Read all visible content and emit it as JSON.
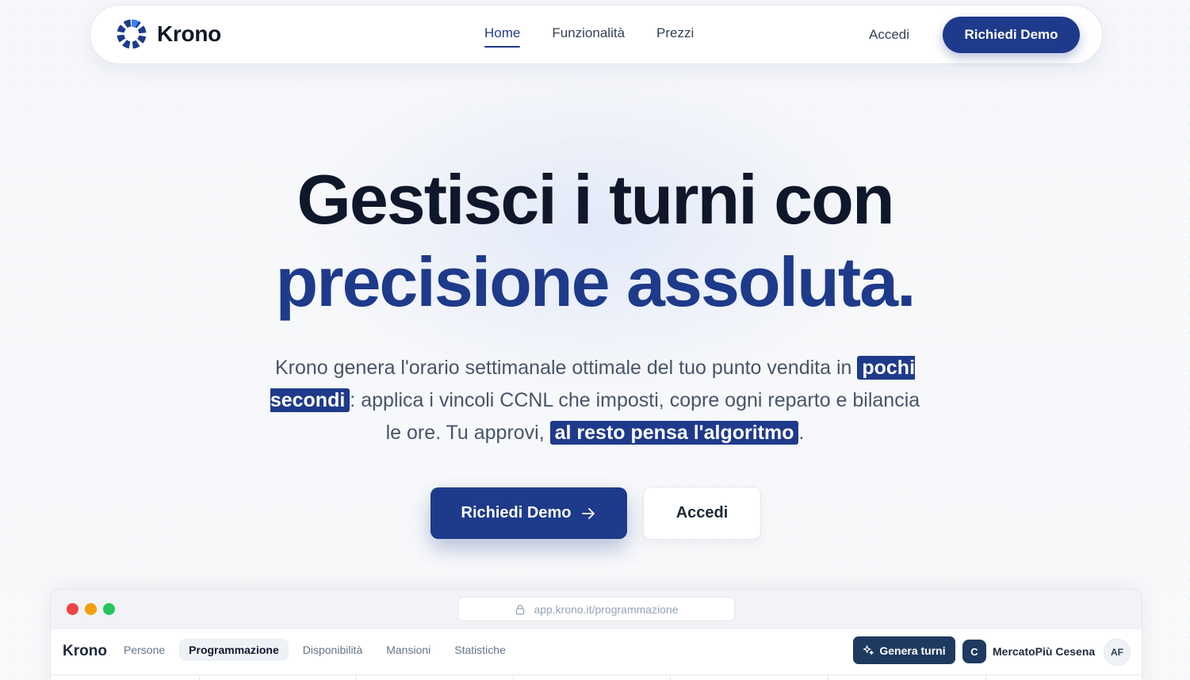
{
  "nav": {
    "brand": "Krono",
    "links": [
      {
        "label": "Home",
        "active": true
      },
      {
        "label": "Funzionalità",
        "active": false
      },
      {
        "label": "Prezzi",
        "active": false
      }
    ],
    "login_label": "Accedi",
    "cta_label": "Richiedi Demo"
  },
  "hero": {
    "title_line1": "Gestisci i turni con",
    "title_line2": "precisione assoluta.",
    "sub_part1": "Krono genera l'orario settimanale ottimale del tuo punto vendita in ",
    "sub_hl1": "pochi secondi",
    "sub_part2": ": applica i vincoli CCNL che imposti, copre ogni reparto e bilancia le ore. Tu approvi, ",
    "sub_hl2": "al resto pensa l'algoritmo",
    "sub_part3": ".",
    "cta_label": "Richiedi Demo",
    "login_label": "Accedi"
  },
  "app_preview": {
    "url": "app.krono.it/programmazione",
    "brand": "Krono",
    "tabs": [
      {
        "label": "Persone",
        "active": false
      },
      {
        "label": "Programmazione",
        "active": true
      },
      {
        "label": "Disponibilità",
        "active": false
      },
      {
        "label": "Mansioni",
        "active": false
      },
      {
        "label": "Statistiche",
        "active": false
      }
    ],
    "generate_label": "Genera turni",
    "store_initial": "C",
    "store_name": "MercatoPiù Cesena",
    "user_initials": "AF"
  },
  "colors": {
    "brand": "#1e3a8a",
    "app_dark": "#1e3a5f",
    "text_dark": "#0f172a",
    "text_muted": "#475569"
  },
  "icons": [
    "krono-logo-icon",
    "arrow-right-icon",
    "lock-icon",
    "sparkles-icon"
  ]
}
